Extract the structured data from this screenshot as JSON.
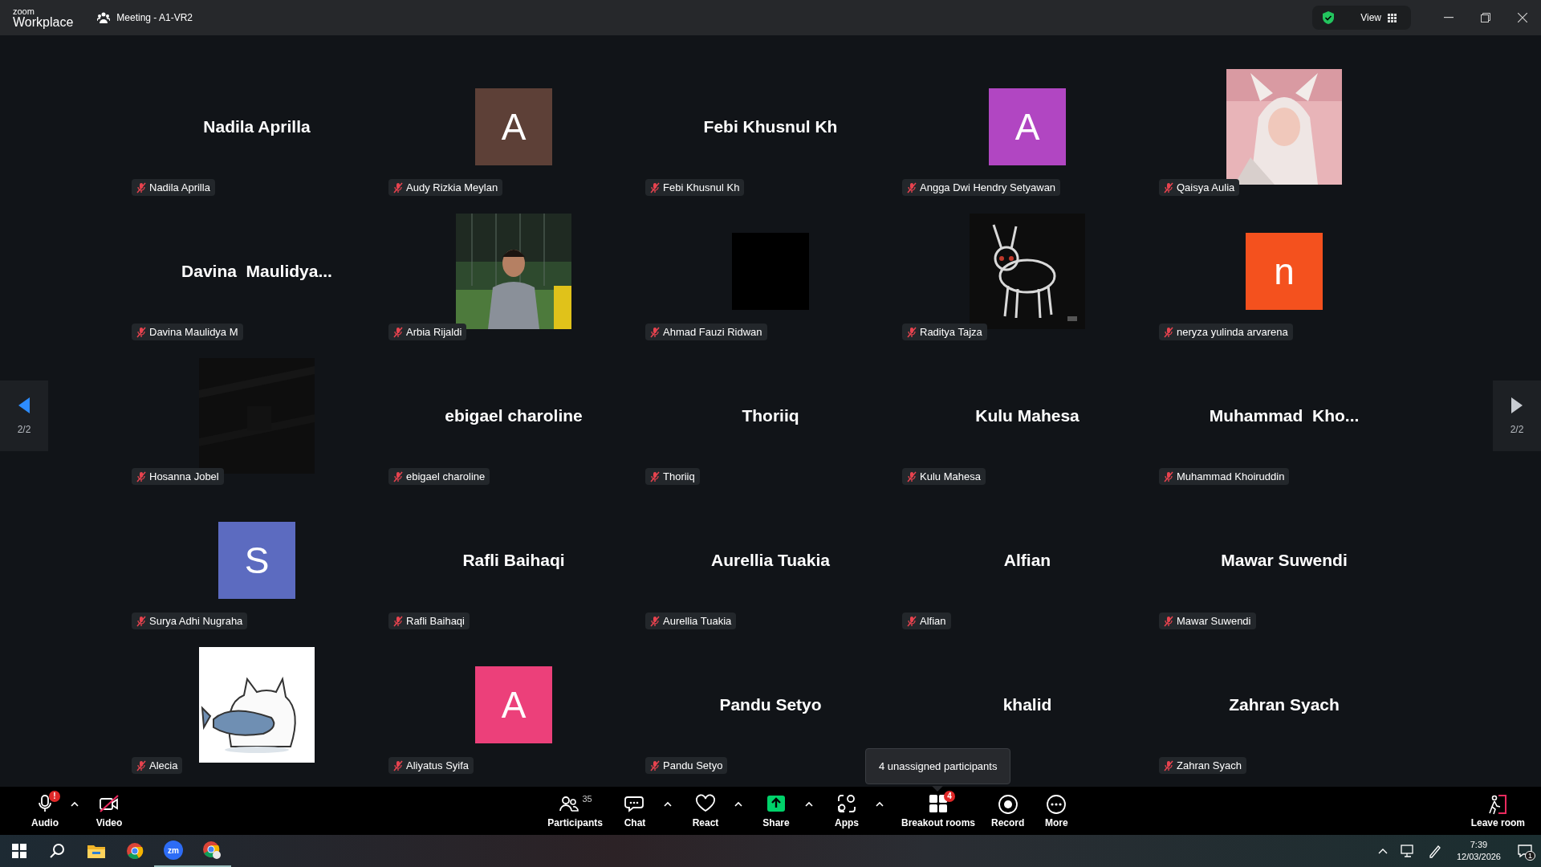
{
  "title_bar": {
    "logo_top": "zoom",
    "logo_bottom": "Workplace",
    "meeting_title": "Meeting - A1-VR2",
    "view_button": "View"
  },
  "tiles": [
    {
      "kind": "name",
      "display": "Nadila Aprilla",
      "name_tag": "Nadila Aprilla"
    },
    {
      "kind": "avatar",
      "letter": "A",
      "color": "#5d4037",
      "name_tag": "Audy Rizkia Meylan"
    },
    {
      "kind": "name",
      "display": "Febi Khusnul Kh",
      "name_tag": "Febi Khusnul Kh"
    },
    {
      "kind": "avatar",
      "letter": "A",
      "color": "#b146c2",
      "name_tag": "Angga Dwi Hendry Setyawan"
    },
    {
      "kind": "picture",
      "name_tag": "Qaisya Aulia"
    },
    {
      "kind": "name",
      "display": "Davina  Maulidya...",
      "name_tag": "Davina Maulidya M"
    },
    {
      "kind": "picture",
      "name_tag": "Arbia Rijaldi"
    },
    {
      "kind": "avatar",
      "color": "#000000",
      "name_tag": "Ahmad Fauzi Ridwan"
    },
    {
      "kind": "picture",
      "name_tag": "Raditya Tajza"
    },
    {
      "kind": "avatar",
      "letter": "n",
      "color": "#f4511e",
      "name_tag": "neryza yulinda arvarena"
    },
    {
      "kind": "picture",
      "name_tag": "Hosanna Jobel"
    },
    {
      "kind": "name",
      "display": "ebigael charoline",
      "name_tag": "ebigael charoline"
    },
    {
      "kind": "name",
      "display": "Thoriiq",
      "name_tag": "Thoriiq"
    },
    {
      "kind": "name",
      "display": "Kulu Mahesa",
      "name_tag": "Kulu Mahesa"
    },
    {
      "kind": "name",
      "display": "Muhammad  Kho...",
      "name_tag": "Muhammad Khoiruddin"
    },
    {
      "kind": "avatar",
      "letter": "S",
      "color": "#5c6bc0",
      "name_tag": "Surya Adhi Nugraha"
    },
    {
      "kind": "name",
      "display": "Rafli Baihaqi",
      "name_tag": "Rafli Baihaqi"
    },
    {
      "kind": "name",
      "display": "Aurellia Tuakia",
      "name_tag": "Aurellia Tuakia"
    },
    {
      "kind": "name",
      "display": "Alfian",
      "name_tag": "Alfian"
    },
    {
      "kind": "name",
      "display": "Mawar Suwendi",
      "name_tag": "Mawar Suwendi"
    },
    {
      "kind": "picture",
      "name_tag": "Alecia"
    },
    {
      "kind": "avatar",
      "letter": "A",
      "color": "#ec407a",
      "name_tag": "Aliyatus Syifa"
    },
    {
      "kind": "name",
      "display": "Pandu Setyo",
      "name_tag": "Pandu Setyo"
    },
    {
      "kind": "name",
      "display": "khalid"
    },
    {
      "kind": "name",
      "display": "Zahran Syach",
      "name_tag": "Zahran Syach"
    }
  ],
  "pager": [
    {
      "kind": "left",
      "label": "2/2",
      "disabled": false
    },
    {
      "kind": "right",
      "label": "2/2",
      "disabled": true
    }
  ],
  "tooltip": "4 unassigned participants",
  "toolbar": {
    "left": [
      {
        "kind": "audio",
        "label": "Audio",
        "badge": "!",
        "has_menu": true
      },
      {
        "kind": "video",
        "label": "Video",
        "has_menu": false
      }
    ],
    "center": [
      {
        "kind": "participants",
        "label": "Participants",
        "count": "35",
        "has_menu": false
      },
      {
        "kind": "chat",
        "label": "Chat",
        "has_menu": true
      },
      {
        "kind": "react",
        "label": "React",
        "has_menu": true
      },
      {
        "kind": "share",
        "label": "Share",
        "has_menu": true
      },
      {
        "kind": "apps",
        "label": "Apps",
        "has_menu": true
      },
      {
        "kind": "breakout",
        "label": "Breakout rooms",
        "badge": "4",
        "has_menu": false
      },
      {
        "kind": "record",
        "label": "Record",
        "has_menu": false
      },
      {
        "kind": "more",
        "label": "More",
        "has_menu": false
      }
    ],
    "leave": "Leave room"
  },
  "taskbar": {
    "zoom_label": "zm",
    "time": "7:39",
    "date": "12/03/2026",
    "notifications": "1"
  }
}
